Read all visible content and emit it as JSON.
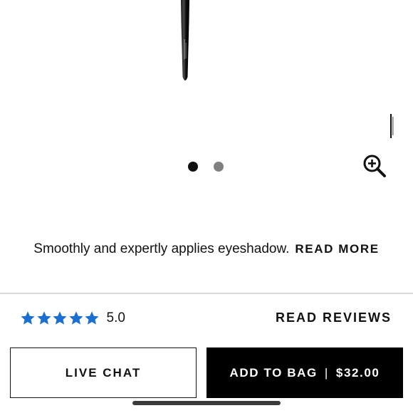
{
  "carousel": {
    "images": [
      "brush-image",
      "brush-image-2"
    ],
    "active_index": 0,
    "zoom_icon": "zoom-in-icon"
  },
  "product": {
    "description": "Smoothly and expertly applies eyeshadow.",
    "read_more_label": "READ MORE"
  },
  "rating": {
    "stars": 5,
    "value": "5.0",
    "star_color": "#1a6fd1",
    "read_reviews_label": "READ REVIEWS"
  },
  "actions": {
    "live_chat_label": "LIVE CHAT",
    "add_to_bag_label": "ADD TO BAG",
    "separator": "|",
    "price": "$32.00"
  }
}
